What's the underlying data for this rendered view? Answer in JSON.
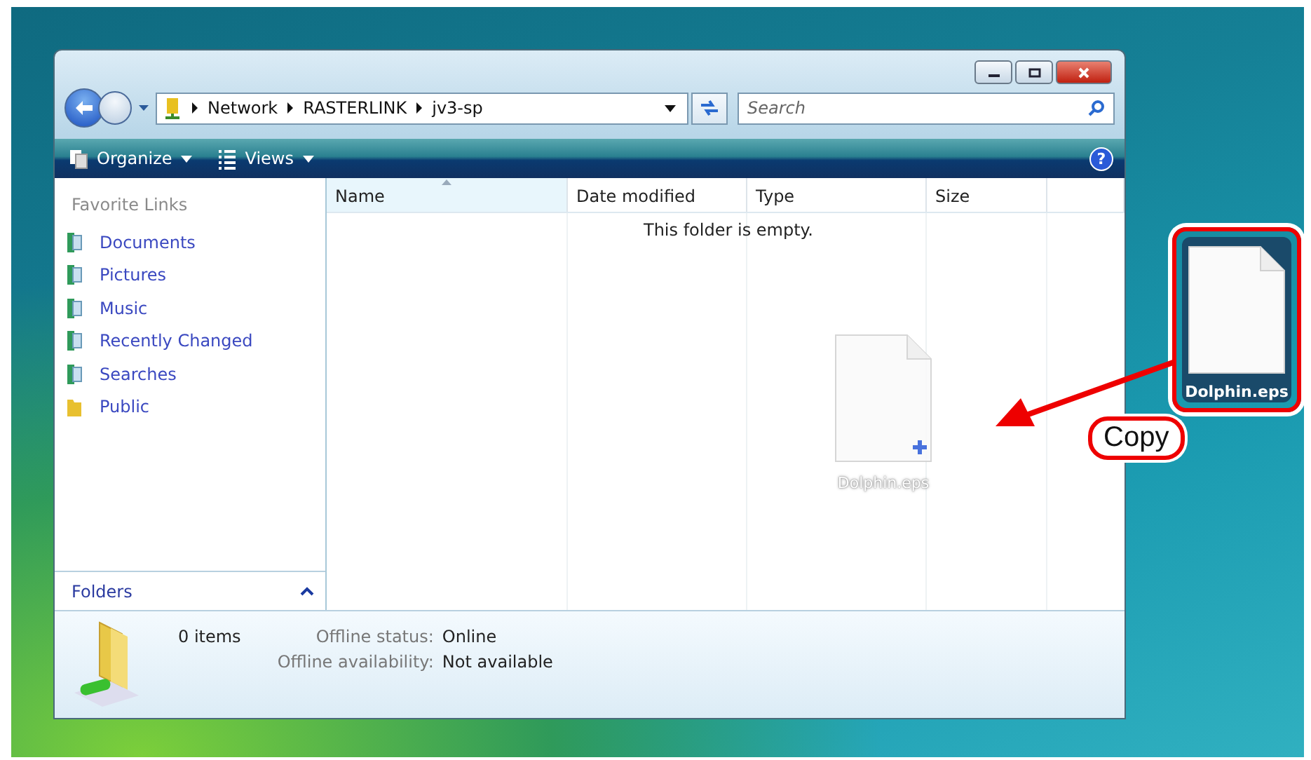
{
  "address": {
    "path": [
      "Network",
      "RASTERLINK",
      "jv3-sp"
    ]
  },
  "search": {
    "placeholder": "Search"
  },
  "toolbar": [
    {
      "label": "Organize"
    },
    {
      "label": "Views"
    }
  ],
  "help": {
    "label": "?"
  },
  "sidebar": {
    "heading": "Favorite Links",
    "items": [
      {
        "label": "Documents"
      },
      {
        "label": "Pictures"
      },
      {
        "label": "Music"
      },
      {
        "label": "Recently Changed"
      },
      {
        "label": "Searches"
      },
      {
        "label": "Public"
      }
    ],
    "folders": {
      "label": "Folders",
      "expanded": false
    }
  },
  "columns": [
    {
      "label": "Name",
      "sorted": true
    },
    {
      "label": "Date modified",
      "sorted": false
    },
    {
      "label": "Type",
      "sorted": false
    },
    {
      "label": "Size",
      "sorted": false
    }
  ],
  "empty_message": "This folder is empty.",
  "drag_ghost": {
    "label": "Dolphin.eps"
  },
  "details": {
    "count": "0 items",
    "fields": [
      {
        "label": "Offline status:",
        "value": "Online"
      },
      {
        "label": "Offline availability:",
        "value": "Not available"
      }
    ]
  },
  "desktop_icon": {
    "label": "Dolphin.eps"
  },
  "callout": {
    "label": "Copy"
  }
}
